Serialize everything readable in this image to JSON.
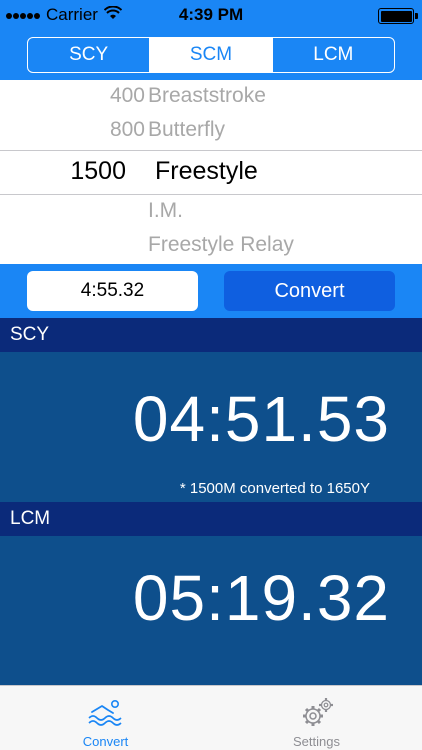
{
  "status_bar": {
    "carrier": "Carrier",
    "time": "4:39 PM"
  },
  "course_tabs": [
    {
      "label": "SCY",
      "selected": false
    },
    {
      "label": "SCM",
      "selected": true
    },
    {
      "label": "LCM",
      "selected": false
    }
  ],
  "picker": {
    "distances": [
      "400",
      "800",
      "1500",
      "",
      ""
    ],
    "events": [
      "Breaststroke",
      "Butterfly",
      "Freestyle",
      "I.M.",
      "Freestyle Relay"
    ],
    "selected_index": 2
  },
  "time_input": {
    "value": "4:55.32"
  },
  "convert_button": {
    "label": "Convert"
  },
  "results": [
    {
      "course": "SCY",
      "time": "04:51.53",
      "note": "* 1500M  converted  to  1650Y"
    },
    {
      "course": "LCM",
      "time": "05:19.32",
      "note": ""
    }
  ],
  "tab_bar": [
    {
      "label": "Convert",
      "icon": "swimmer-icon",
      "active": true
    },
    {
      "label": "Settings",
      "icon": "gears-icon",
      "active": false
    }
  ],
  "colors": {
    "accent": "#1a86f5",
    "button": "#0f5fe0",
    "section_header": "#0b2a7a",
    "section_body": "#0e4f8c"
  }
}
